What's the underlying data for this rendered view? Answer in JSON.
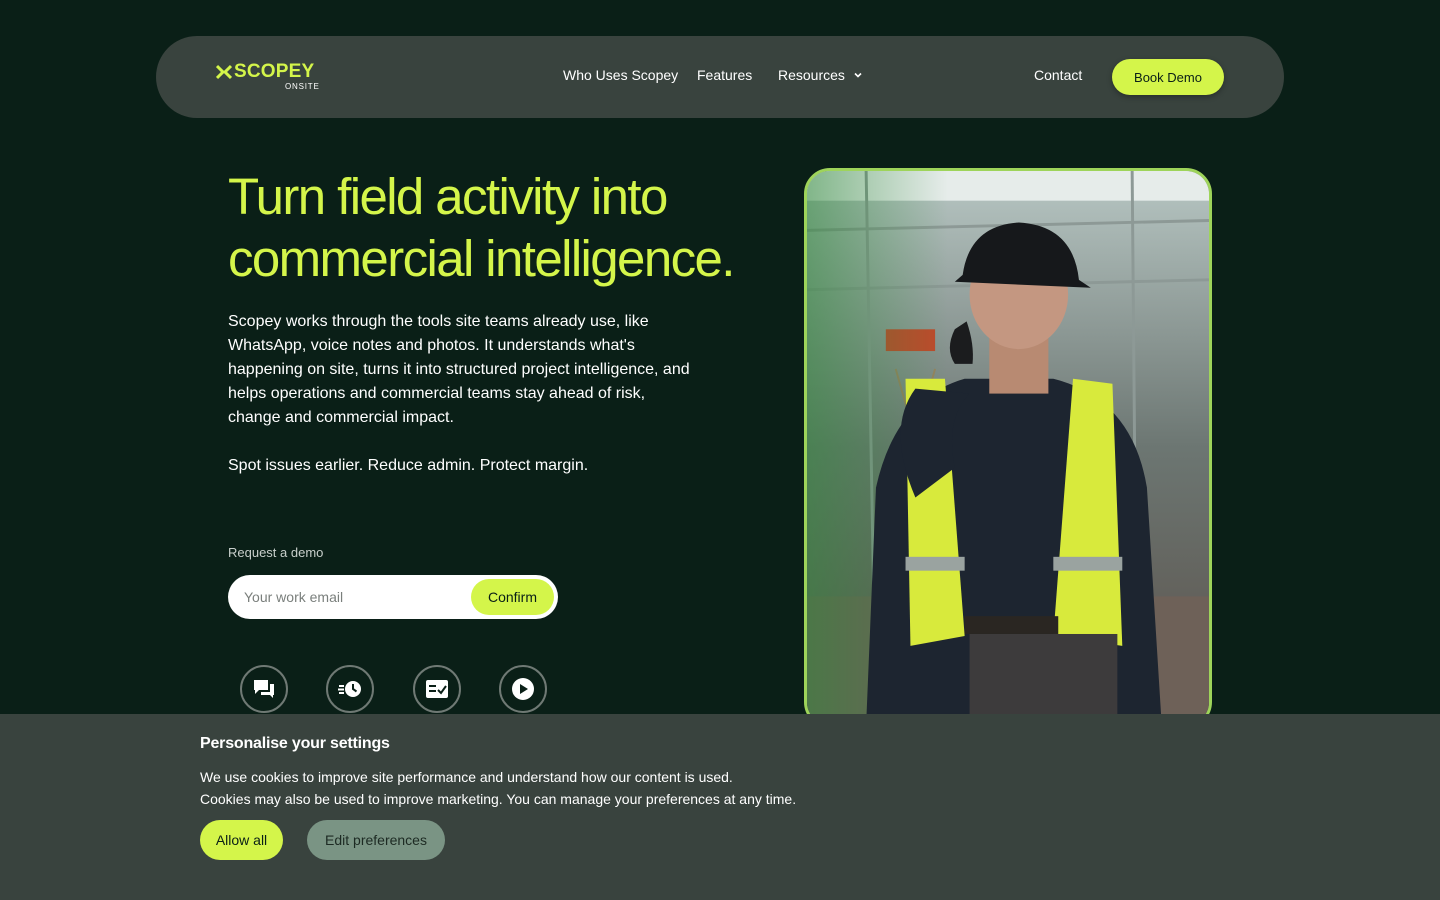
{
  "nav": {
    "logo_word": "SCOPEY",
    "logo_sub": "ONSITE",
    "links": {
      "who": "Who Uses Scopey",
      "features": "Features",
      "resources": "Resources",
      "contact": "Contact"
    },
    "book_demo": "Book Demo"
  },
  "hero": {
    "headline_line1": "Turn field activity into",
    "headline_line2": "commercial intelligence.",
    "lead": "Scopey works through the tools site teams already use, like WhatsApp, voice notes and photos. It understands what's happening on site, turns it into structured project intelligence, and helps operations and commercial teams stay ahead of risk, change and commercial impact.",
    "tagline": "Spot issues earlier. Reduce admin. Protect margin.",
    "request_label": "Request a demo",
    "email_placeholder": "Your work email",
    "email_value": "",
    "confirm": "Confirm"
  },
  "features_icons": [
    "chat-icon",
    "fast-clock-icon",
    "checklist-icon",
    "play-icon"
  ],
  "cookie": {
    "title": "Personalise your settings",
    "line1": "We use cookies to improve site performance and understand how our content is used.",
    "line2": "Cookies may also be used to improve marketing. You can manage your preferences at any time.",
    "allow_all": "Allow all",
    "edit_preferences": "Edit preferences"
  },
  "colors": {
    "background": "#0a1f17",
    "panel": "#39433e",
    "accent": "#d4f54a",
    "muted_button": "#7a9484"
  }
}
